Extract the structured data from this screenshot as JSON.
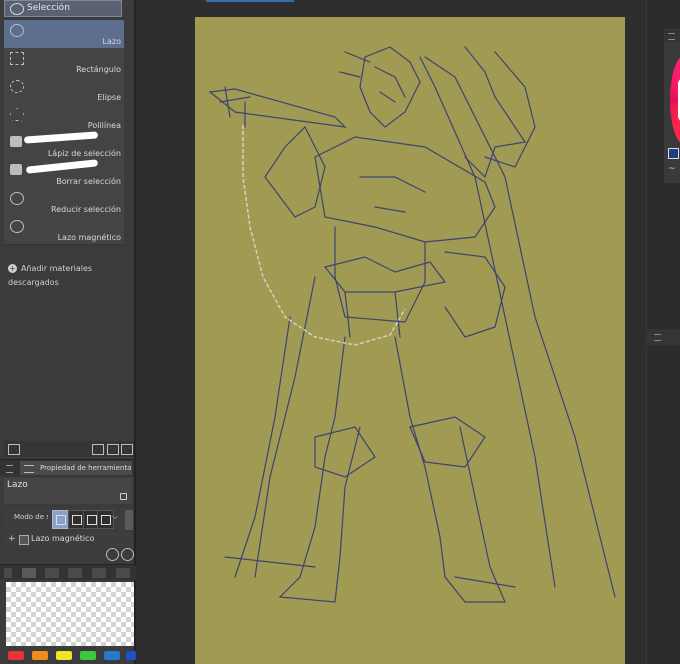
{
  "tool_panel": {
    "subtool_tab": "Selección",
    "tools": [
      {
        "label": "Lazo",
        "icon": "lasso-icon",
        "active": true
      },
      {
        "label": "Rectángulo",
        "icon": "rectangle-select-icon",
        "active": false
      },
      {
        "label": "Elipse",
        "icon": "ellipse-select-icon",
        "active": false
      },
      {
        "label": "Polilínea",
        "icon": "polyline-select-icon",
        "active": false
      },
      {
        "label": "Lápiz de selección",
        "icon": "selection-pen-icon",
        "active": false
      },
      {
        "label": "Borrar selección",
        "icon": "selection-eraser-icon",
        "active": false
      },
      {
        "label": "Reducir selección",
        "icon": "lasso-icon",
        "active": false
      },
      {
        "label": "Lazo magnético",
        "icon": "lasso-icon",
        "active": false
      }
    ],
    "add_material": "Añadir materiales descargados"
  },
  "tool_property": {
    "tab_label": "Propiedad de herramienta",
    "tool_name": "Lazo",
    "mode_label": "Modo de s",
    "magnetic_lasso": "Lazo magnético"
  },
  "color_panel": {
    "swatches": [
      "#e8323c",
      "#f08c1e",
      "#f0e628",
      "#3cc83c",
      "#2878c8",
      "#1e50c8"
    ],
    "primary_color": "#1e3e80"
  },
  "canvas": {
    "background": "#a09a52"
  }
}
